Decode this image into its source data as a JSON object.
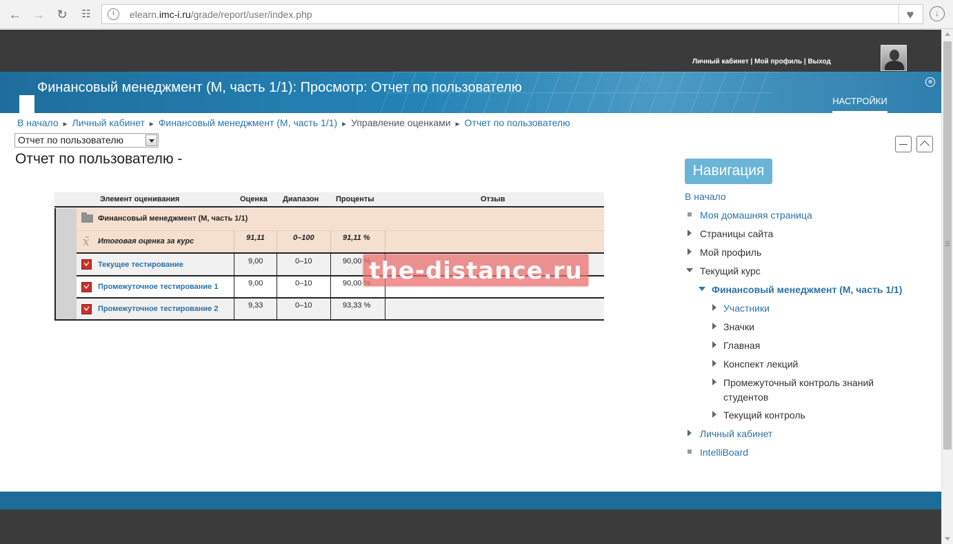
{
  "browser": {
    "url_host_prefix": "elearn.",
    "url_host_main": "imc-i.ru",
    "url_path": "/grade/report/user/index.php"
  },
  "header": {
    "user_links": "Личный кабинет | Мой профиль | Выход",
    "title": "Финансовый менеджмент (М, часть 1/1): Просмотр: Отчет по пользователю",
    "settings_tab": "НАСТРОЙКИ"
  },
  "breadcrumb": {
    "items": [
      "В начало",
      "Личный кабинет",
      "Финансовый менеджмент (М, часть 1/1)",
      "Управление оценками",
      "Отчет по пользователю"
    ],
    "separator": "►"
  },
  "report_select": {
    "value": "Отчет по пользователю"
  },
  "report_title": "Отчет по пользователю -",
  "grade_table": {
    "headers": [
      "Элемент оценивания",
      "Оценка",
      "Диапазон",
      "Проценты",
      "Отзыв"
    ],
    "category": "Финансовый менеджмент (М, часть 1/1)",
    "course_total": {
      "name": "Итоговая оценка за курс",
      "grade": "91,11",
      "range": "0–100",
      "percent": "91,11 %",
      "feedback": ""
    },
    "items": [
      {
        "name": "Текущее тестирование",
        "grade": "9,00",
        "range": "0–10",
        "percent": "90,00 %",
        "feedback": ""
      },
      {
        "name": "Промежуточное тестирование 1",
        "grade": "9,00",
        "range": "0–10",
        "percent": "90,00 %",
        "feedback": ""
      },
      {
        "name": "Промежуточное тестирование 2",
        "grade": "9,33",
        "range": "0–10",
        "percent": "93,33 %",
        "feedback": ""
      }
    ]
  },
  "watermark": "the-distance.ru",
  "navigation": {
    "title": "Навигация",
    "home": "В начало",
    "items": {
      "my_home": "Моя домашняя страница",
      "site_pages": "Страницы сайта",
      "my_profile": "Мой профиль",
      "current_course": "Текущий курс",
      "course": "Финансовый менеджмент (М, часть 1/1)",
      "participants": "Участники",
      "badges": "Значки",
      "general": "Главная",
      "lectures": "Конспект лекций",
      "interim_control_1": "Промежуточный контроль знаний",
      "interim_control_2": "студентов",
      "current_control": "Текущий контроль",
      "dashboard": "Личный кабинет",
      "intelliboard": "IntelliBoard"
    }
  },
  "colors": {
    "banner_blue": "#2584b5",
    "dark_bar": "#3b3b3b",
    "link_blue": "#2a73a8",
    "category_row": "#f5dfcf",
    "nav_button": "#6ab4d8"
  }
}
